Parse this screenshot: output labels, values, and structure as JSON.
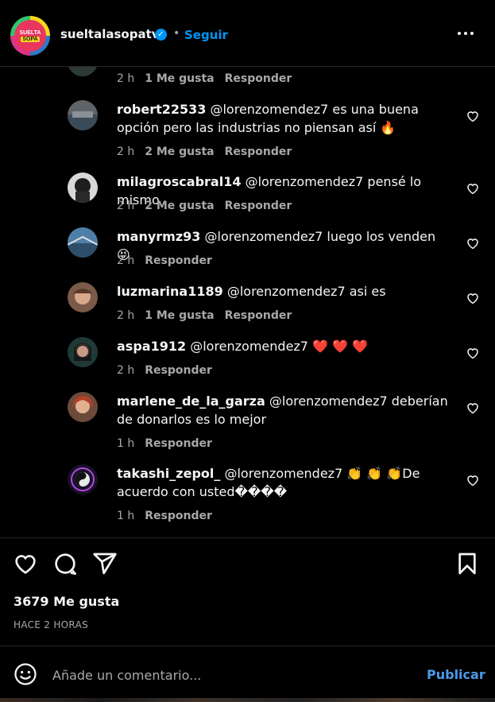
{
  "header": {
    "logo_top": "SUELTA",
    "logo_bottom": "SOPA",
    "username": "sueltalasopatv",
    "verified_icon": "verified-badge-icon",
    "separator": "•",
    "follow_label": "Seguir",
    "more_icon": "more-options-icon"
  },
  "comments": [
    {
      "user": "",
      "text": "",
      "time": "2 h",
      "likes": "1 Me gusta",
      "reply": "Responder"
    },
    {
      "user": "robert22533",
      "text": "@lorenzomendez7 es una buena opción pero las industrias no piensan así 🔥",
      "time": "2 h",
      "likes": "2 Me gusta",
      "reply": "Responder"
    },
    {
      "user": "milagroscabral14",
      "text": "@lorenzomendez7 pensé lo mismo",
      "time": "2 h",
      "likes": "2 Me gusta",
      "reply": "Responder"
    },
    {
      "user": "manyrmz93",
      "text": "@lorenzomendez7 luego los venden 😝",
      "time": "2 h",
      "likes": "",
      "reply": "Responder"
    },
    {
      "user": "luzmarina1189",
      "text": "@lorenzomendez7 asi es",
      "time": "2 h",
      "likes": "1 Me gusta",
      "reply": "Responder"
    },
    {
      "user": "aspa1912",
      "text": "@lorenzomendez7 ❤️ ❤️ ❤️",
      "time": "2 h",
      "likes": "",
      "reply": "Responder"
    },
    {
      "user": "marlene_de_la_garza",
      "text": "@lorenzomendez7 deberían de donarlos es lo mejor",
      "time": "1 h",
      "likes": "",
      "reply": "Responder"
    },
    {
      "user": "takashi_zepol_",
      "text": "@lorenzomendez7 👏 👏 👏De acuerdo con usted����",
      "time": "1 h",
      "likes": "",
      "reply": "Responder"
    }
  ],
  "actions": {
    "like_icon": "heart-icon",
    "comment_icon": "comment-icon",
    "share_icon": "share-icon",
    "save_icon": "bookmark-icon",
    "likes_count": "3679 Me gusta",
    "timestamp": "HACE 2 HORAS"
  },
  "compose": {
    "emoji_icon": "emoji-icon",
    "placeholder": "Añade un comentario...",
    "publish_label": "Publicar"
  },
  "colors": {
    "background": "#000000",
    "text": "#f5f5f5",
    "muted": "#a8a8a8",
    "link": "#0095f6",
    "publish": "#4c9aeb"
  }
}
